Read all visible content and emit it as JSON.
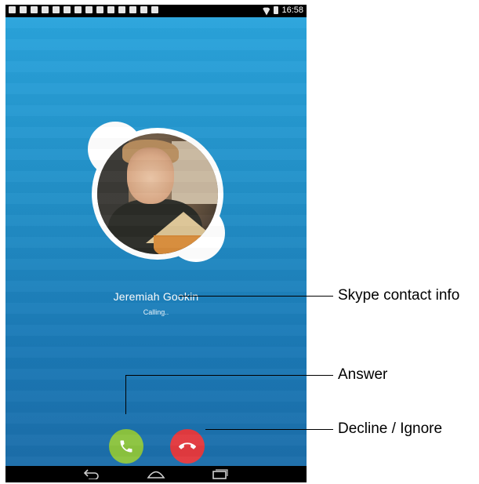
{
  "status_bar": {
    "time": "16:58",
    "notification_icons": [
      "chat-icon",
      "chat-icon",
      "clipboard-icon",
      "mail-icon",
      "download-icon",
      "download-icon",
      "download-icon",
      "download-icon",
      "mail-icon",
      "contact-icon",
      "document-icon",
      "calendar-check-icon",
      "play-store-icon",
      "calendar-check-icon"
    ],
    "wifi_icon": "wifi-icon",
    "battery_icon": "battery-icon"
  },
  "call": {
    "contact_name": "Jeremiah Gookin",
    "status": "Calling.."
  },
  "buttons": {
    "answer_icon": "phone-icon",
    "decline_icon": "hang-up-icon"
  },
  "nav": {
    "back_icon": "back-icon",
    "home_icon": "home-icon",
    "recents_icon": "recents-icon"
  },
  "callouts": {
    "contact_info": "Skype contact info",
    "answer": "Answer",
    "decline": "Decline / Ignore"
  },
  "colors": {
    "accent_blue": "#2290c8",
    "answer_green": "#8cc43f",
    "decline_red": "#e23a3f"
  }
}
